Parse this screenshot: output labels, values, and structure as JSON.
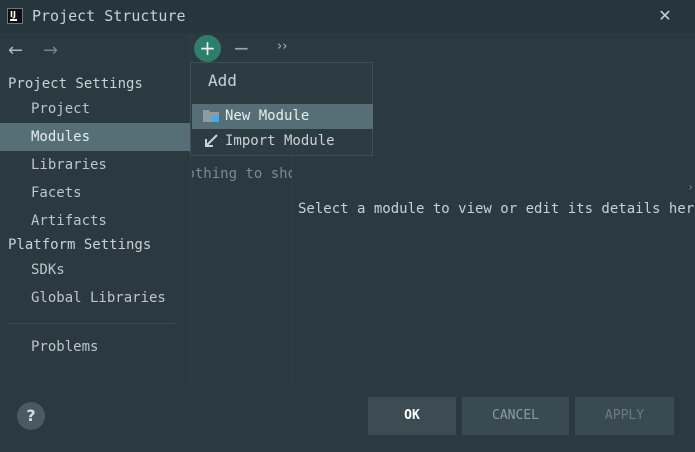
{
  "window": {
    "title": "Project Structure",
    "app_icon_text": "IJ"
  },
  "sidebar": {
    "sections": [
      {
        "header": "Project Settings",
        "items": [
          "Project",
          "Modules",
          "Libraries",
          "Facets",
          "Artifacts"
        ]
      },
      {
        "header": "Platform Settings",
        "items": [
          "SDKs",
          "Global Libraries"
        ]
      }
    ],
    "extra_items": [
      "Problems"
    ],
    "selected": "Modules"
  },
  "toolbar": {
    "add": "+",
    "remove": "−",
    "more": "››"
  },
  "add_popup": {
    "title": "Add",
    "items": [
      "New Module",
      "Import Module"
    ],
    "highlighted": "New Module"
  },
  "module_list": {
    "empty_text": "Nothing to show"
  },
  "details": {
    "placeholder": "Select a module to view or edit its details here"
  },
  "footer": {
    "help": "?",
    "ok": "OK",
    "cancel": "CANCEL",
    "apply": "APPLY"
  },
  "colors": {
    "selection": "#566e76",
    "accent": "#2f7d6b",
    "background": "#2b3940"
  }
}
